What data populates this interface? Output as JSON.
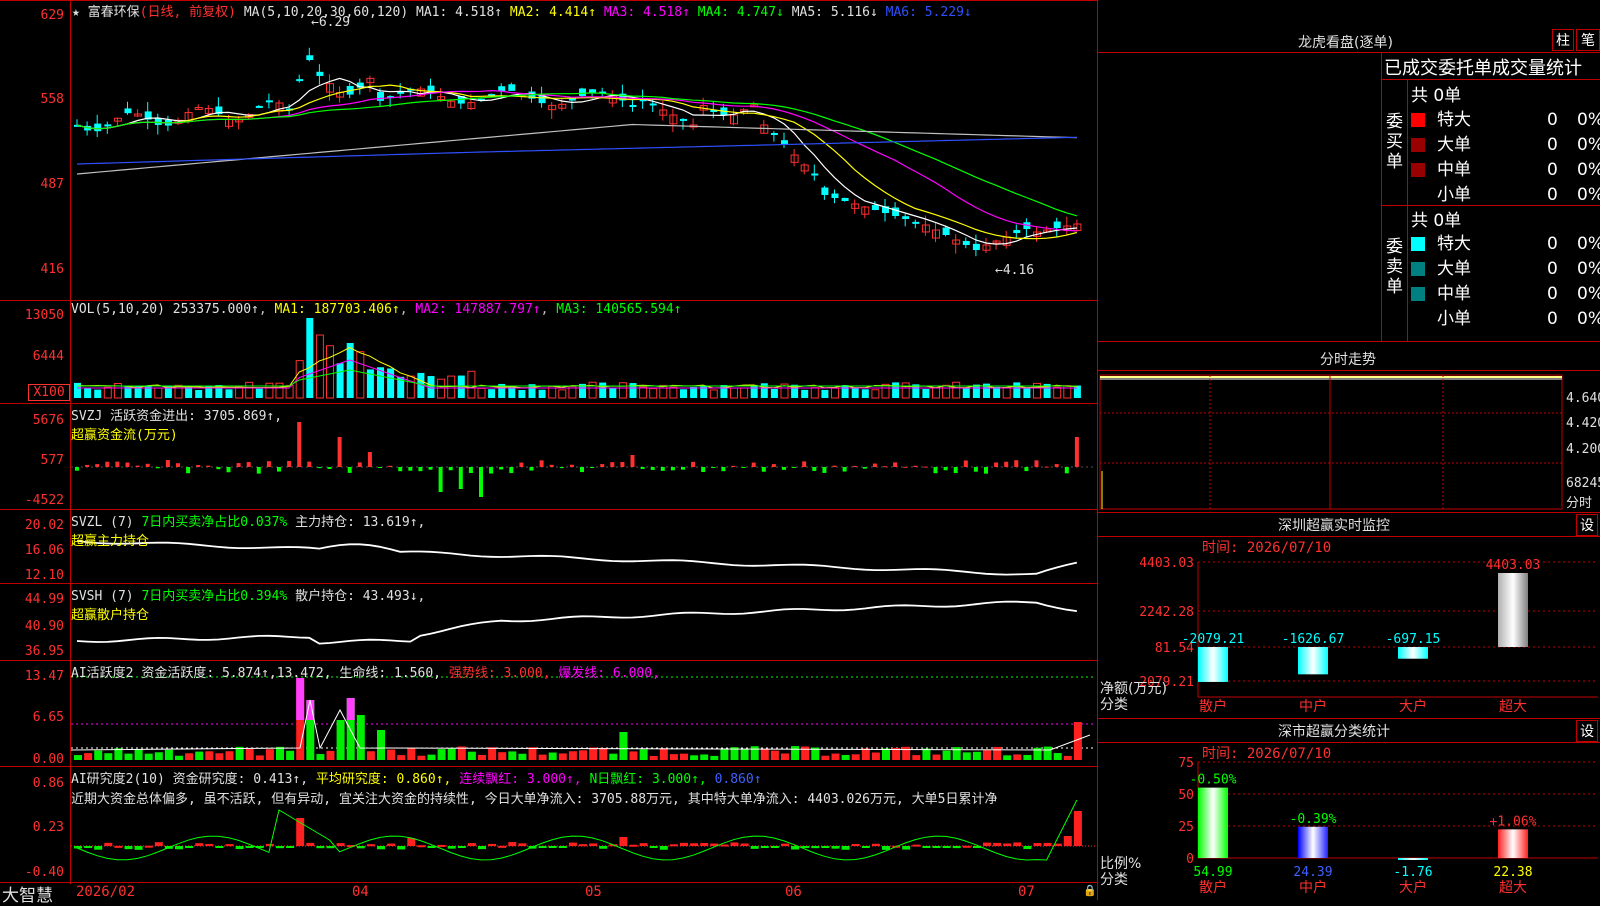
{
  "stock": {
    "name": "富春环保",
    "mode": "(日线, 前复权)"
  },
  "header": {
    "ma_label": "MA(5,10,20,30,60,120)",
    "ma": [
      {
        "k": "MA1:",
        "v": "4.518↑",
        "c": "#e0e0e0"
      },
      {
        "k": "MA2:",
        "v": "4.414↑",
        "c": "#ffff00"
      },
      {
        "k": "MA3:",
        "v": "4.518↑",
        "c": "#ff00ff"
      },
      {
        "k": "MA4:",
        "v": "4.747↓",
        "c": "#00ff00"
      },
      {
        "k": "MA5:",
        "v": "5.116↓",
        "c": "#e0e0e0"
      },
      {
        "k": "MA6:",
        "v": "5.229↓",
        "c": "#3050ff"
      }
    ]
  },
  "price_axis": [
    "629",
    "558",
    "487",
    "416"
  ],
  "price_marks": {
    "high": "6.29",
    "low": "4.16"
  },
  "vol": {
    "title": "VOL(5,10,20)",
    "val": "253375.000↑",
    "ma1": "MA1: 187703.406↑",
    "ma2": "MA2: 147887.797↑",
    "ma3": "MA3: 140565.594↑",
    "axis": [
      "13050",
      "6444",
      "X100"
    ]
  },
  "svzj": {
    "title": "SVZJ",
    "t1": "活跃资金进出: 3705.869↑,",
    "t2": "超赢资金流(万元)",
    "axis": [
      "5676",
      "577",
      "-4522"
    ]
  },
  "svzl": {
    "title": "SVZL (7)",
    "t1": "7日内买卖净占比0.037%",
    "t2": "主力持仓: 13.619↑,",
    "t3": "超赢主力持仓",
    "axis": [
      "20.02",
      "16.06",
      "12.10"
    ]
  },
  "svsh": {
    "title": "SVSH (7)",
    "t1": "7日内买卖净占比0.394%",
    "t2": "散户持仓: 43.493↓,",
    "t3": "超赢散户持仓",
    "axis": [
      "44.99",
      "40.90",
      "36.95"
    ]
  },
  "ai1": {
    "title": "AI活跃度2",
    "t1": "资金活跃度: 5.874↑,13.472,",
    "t2": "生命线: 1.560,",
    "t3": "强势线: 3.000,",
    "t4": "爆发线: 6.000,",
    "axis": [
      "13.47",
      "6.65",
      "0.00"
    ]
  },
  "ai2": {
    "title": "AI研究度2(10)",
    "t1": "资金研究度: 0.413↑,",
    "t2": "平均研究度: 0.860↑,",
    "t3": "连续飘红: 3.000↑,",
    "t4": "N日飘红: 3.000↑,",
    "t5": "0.860↑",
    "note": "近期大资金总体偏多, 虽不活跃, 但有异动, 宜关注大资金的持续性, 今日大单净流入: 3705.88万元, 其中特大单净流入: 4403.026万元, 大单5日累计净",
    "axis": [
      "0.86",
      "0.23",
      "-0.40"
    ]
  },
  "xaxis": {
    "brand": "大智慧",
    "labels": [
      "2026/02",
      "04",
      "05",
      "06",
      "07"
    ]
  },
  "lhb": {
    "title": "龙虎看盘(逐单)",
    "btn1": "柱",
    "btn2": "笔",
    "tabs": "已成交委托单成交量统计",
    "buy": {
      "label": "委买单",
      "total": "共 0单",
      "rows": [
        {
          "n": "特大",
          "v": "0",
          "p": "0%",
          "c": "#ff0000"
        },
        {
          "n": "大单",
          "v": "0",
          "p": "0%",
          "c": "#990000"
        },
        {
          "n": "中单",
          "v": "0",
          "p": "0%",
          "c": "#990000"
        },
        {
          "n": "小单",
          "v": "0",
          "p": "0%",
          "c": "#000000"
        }
      ]
    },
    "sell": {
      "label": "委卖单",
      "total": "共 0单",
      "rows": [
        {
          "n": "特大",
          "v": "0",
          "p": "0%",
          "c": "#00ffff"
        },
        {
          "n": "大单",
          "v": "0",
          "p": "0%",
          "c": "#008080"
        },
        {
          "n": "中单",
          "v": "0",
          "p": "0%",
          "c": "#008080"
        },
        {
          "n": "小单",
          "v": "0",
          "p": "0%",
          "c": "#000000"
        }
      ]
    }
  },
  "fenshi": {
    "title": "分时走势",
    "axis": [
      "4.640",
      "4.420",
      "4.200"
    ],
    "vol": "68245",
    "lab": "分时"
  },
  "monitor": {
    "title": "深圳超赢实时监控",
    "btn": "设",
    "time": "时间: 2026/07/10",
    "axis": [
      "4403.03",
      "2242.28",
      "81.54",
      "-2079.21"
    ],
    "ylabel": "净额(万元)",
    "xcat": "分类",
    "bars": [
      {
        "n": "散户",
        "v": -2079.21,
        "t": "-2079.21"
      },
      {
        "n": "中户",
        "v": -1626.67,
        "t": "-1626.67"
      },
      {
        "n": "大户",
        "v": -697.15,
        "t": "-697.15"
      },
      {
        "n": "超大",
        "v": 4403.03,
        "t": "4403.03"
      }
    ]
  },
  "classify": {
    "title": "深市超赢分类统计",
    "btn": "设",
    "time": "时间: 2026/07/10",
    "axis": [
      "75",
      "50",
      "25",
      "0"
    ],
    "ylabel": "比例%",
    "xcat": "分类",
    "bars": [
      {
        "n": "散户",
        "top": "-0.50%",
        "v": 54.99,
        "t": "54.99"
      },
      {
        "n": "中户",
        "top": "-0.39%",
        "v": 24.39,
        "t": "24.39"
      },
      {
        "n": "大户",
        "top": "",
        "v": -1.76,
        "t": "-1.76"
      },
      {
        "n": "超大",
        "top": "+1.06%",
        "v": 22.38,
        "t": "22.38"
      }
    ]
  }
}
